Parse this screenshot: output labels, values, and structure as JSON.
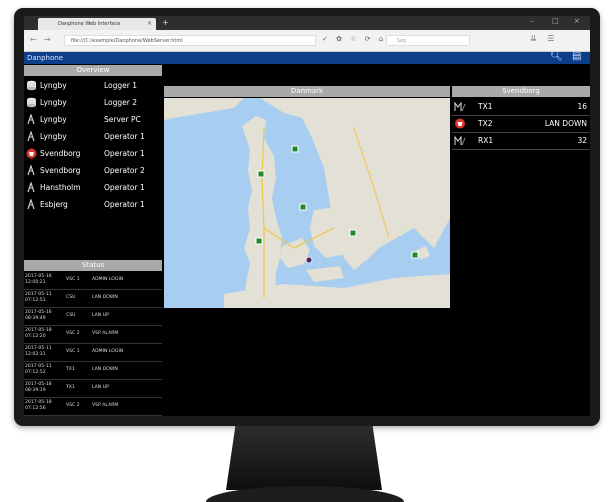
{
  "browser": {
    "tab_title": "Danphone Web Interface",
    "tab_close": "×",
    "new_tab": "+",
    "window_controls": [
      "–",
      "□",
      "×"
    ],
    "nav_back": "←",
    "nav_forward": "→",
    "url": "file:///C:/example/Danphone/WebServer.html",
    "url_tools": "✓ ✿ ☆ ⟳ ⌂",
    "search_placeholder": "Søg",
    "right_tools": "⇊ ☰"
  },
  "app": {
    "name": "Danphone",
    "header_icons": [
      "search-icon",
      "export-icon"
    ]
  },
  "overview": {
    "title": "Overview",
    "rows": [
      {
        "location": "Lyngby",
        "device": "Logger 1",
        "icon": "server-icon"
      },
      {
        "location": "Lyngby",
        "device": "Logger 2",
        "icon": "server-icon"
      },
      {
        "location": "Lyngby",
        "device": "Server PC",
        "icon": "antenna-icon"
      },
      {
        "location": "Lyngby",
        "device": "Operator 1",
        "icon": "antenna-icon"
      },
      {
        "location": "Svendborg",
        "device": "Operator 1",
        "icon": "alarm-icon"
      },
      {
        "location": "Svendborg",
        "device": "Operator 2",
        "icon": "antenna-icon"
      },
      {
        "location": "Hanstholm",
        "device": "Operator 1",
        "icon": "antenna-icon"
      },
      {
        "location": "Esbjerg",
        "device": "Operator 1",
        "icon": "antenna-icon"
      }
    ]
  },
  "status": {
    "title": "Status",
    "rows": [
      {
        "date": "2017-05-16",
        "time": "12:00:21",
        "device": "VSC 1",
        "message": "ADMIN LOGIN"
      },
      {
        "date": "2017-05-11",
        "time": "07:12:51",
        "device": "CSU",
        "message": "LAN DOWN"
      },
      {
        "date": "2017-05-16",
        "time": "08:39:49",
        "device": "CSU",
        "message": "LAN UP"
      },
      {
        "date": "2017-05-18",
        "time": "07:12:20",
        "device": "VSC 2",
        "message": "VSP ALARM"
      },
      {
        "date": "2017-05-11",
        "time": "12:02:31",
        "device": "VSC 1",
        "message": "ADMIN LOGIN"
      },
      {
        "date": "2017-05-11",
        "time": "07:12:52",
        "device": "TX1",
        "message": "LAN DOWN"
      },
      {
        "date": "2017-05-18",
        "time": "08:39:19",
        "device": "TX1",
        "message": "LAN UP"
      },
      {
        "date": "2017-05-18",
        "time": "07:12:56",
        "device": "VSC 2",
        "message": "VSP ALARM"
      }
    ]
  },
  "map": {
    "title": "Danmark"
  },
  "station": {
    "title": "Svendborg",
    "rows": [
      {
        "name": "TX1",
        "value": "16",
        "icon": "antenna-icon"
      },
      {
        "name": "TX2",
        "value": "LAN DOWN",
        "icon": "alarm-icon"
      },
      {
        "name": "RX1",
        "value": "32",
        "icon": "antenna-icon"
      }
    ]
  },
  "colors": {
    "app_bar": "#0c3e8a",
    "panel_header": "#a9a9a9",
    "alarm": "#d9352b",
    "marker": "#1f8a2a",
    "water": "#a7cdf0",
    "land": "#e3e0d6"
  }
}
